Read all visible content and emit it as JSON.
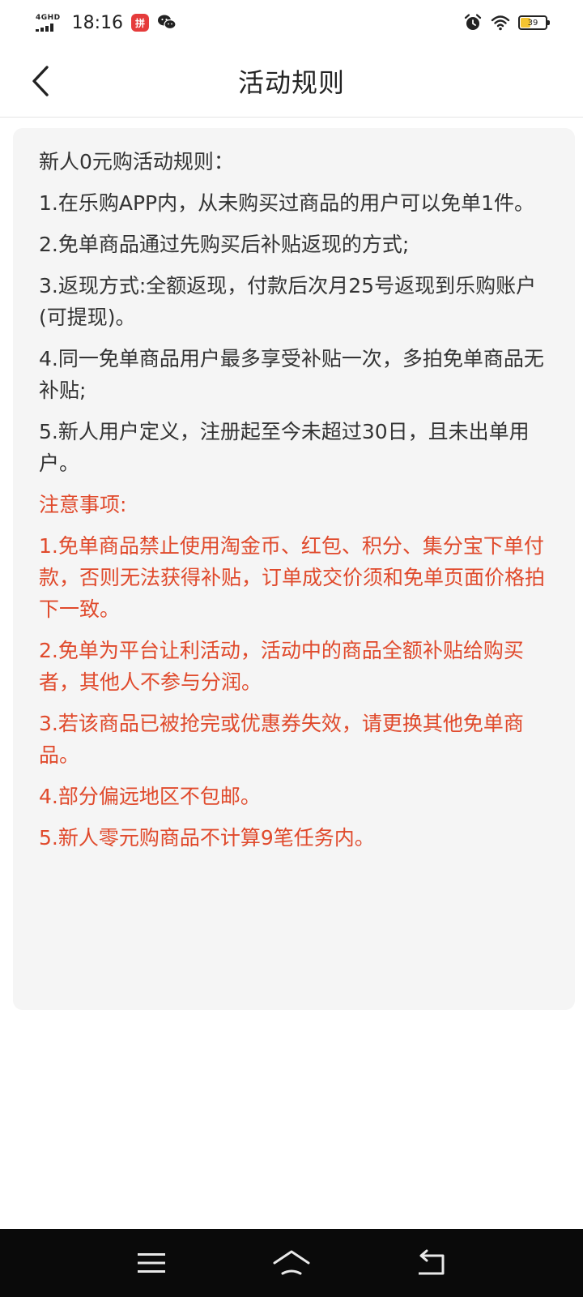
{
  "status_bar": {
    "network": "4GHD",
    "time": "18:16",
    "app_badge": "拼",
    "battery_level": 39,
    "battery_text": "39"
  },
  "header": {
    "title": "活动规则"
  },
  "rules": {
    "intro": "新人0元购活动规则：",
    "items": [
      "1.在乐购APP内，从未购买过商品的用户可以免单1件。",
      "2.免单商品通过先购买后补贴返现的方式;",
      "3.返现方式:全额返现，付款后次月25号返现到乐购账户(可提现)。",
      "4.同一免单商品用户最多享受补贴一次，多拍免单商品无补贴;",
      "5.新人用户定义，注册起至今未超过30日，且未出单用户。"
    ],
    "notice_title": "注意事项:",
    "notice_items": [
      "1.免单商品禁止使用淘金币、红包、积分、集分宝下单付款，否则无法获得补贴，订单成交价须和免单页面价格拍下一致。",
      "2.免单为平台让利活动，活动中的商品全额补贴给购买者，其他人不参与分润。",
      "3.若该商品已被抢完或优惠券失效，请更换其他免单商品。",
      "4.部分偏远地区不包邮。",
      "5.新人零元购商品不计算9笔任务内。"
    ]
  },
  "colors": {
    "notice_red": "#e04a2c",
    "card_bg": "#f5f5f5",
    "nav_bg": "#0a0a0a"
  }
}
